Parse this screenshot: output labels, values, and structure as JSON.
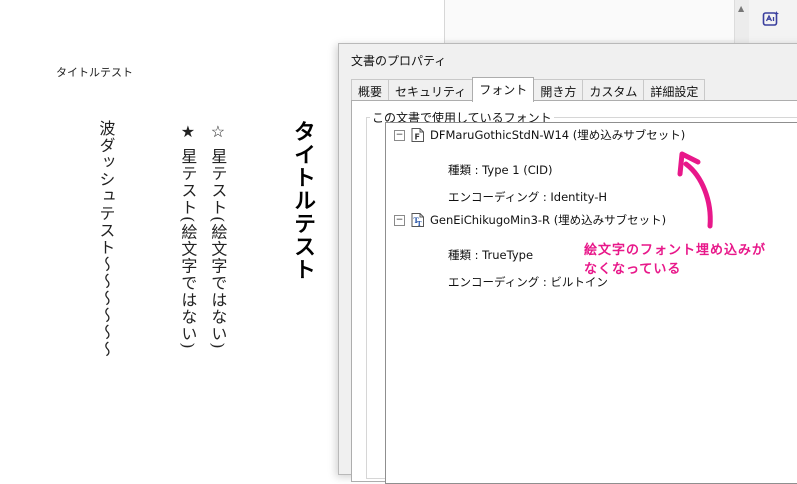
{
  "document": {
    "header_title": "タイトルテスト",
    "column_wave": "波ダッシュテスト〜〜〜〜〜〜",
    "column_star_black": "★ 星テスト(絵文字ではない)",
    "column_star_white": "☆ 星テスト(絵文字ではない)",
    "bold_title": "タイトルテスト"
  },
  "dialog": {
    "title": "文書のプロパティ",
    "tabs": [
      {
        "label": "概要"
      },
      {
        "label": "セキュリティ"
      },
      {
        "label": "フォント"
      },
      {
        "label": "開き方"
      },
      {
        "label": "カスタム"
      },
      {
        "label": "詳細設定"
      }
    ],
    "group_label": "この文書で使用しているフォント",
    "fonts": [
      {
        "name": "DFMaruGothicStdN-W14 (埋め込みサブセット)",
        "icon": "type1-font-icon",
        "type": "種類 : Type 1 (CID)",
        "encoding": "エンコーディング : Identity-H"
      },
      {
        "name": "GenEiChikugoMin3-R (埋め込みサブセット)",
        "icon": "truetype-font-icon",
        "type": "種類 : TrueType",
        "encoding": "エンコーディング : ビルトイン"
      }
    ]
  },
  "annotation": {
    "line1": "絵文字のフォント埋め込みが",
    "line2": "なくなっている",
    "color": "#e8188a"
  },
  "colors": {
    "dialog_bg": "#f0f0f0",
    "panel_bg": "#ffffff",
    "accent": "#e8188a"
  }
}
